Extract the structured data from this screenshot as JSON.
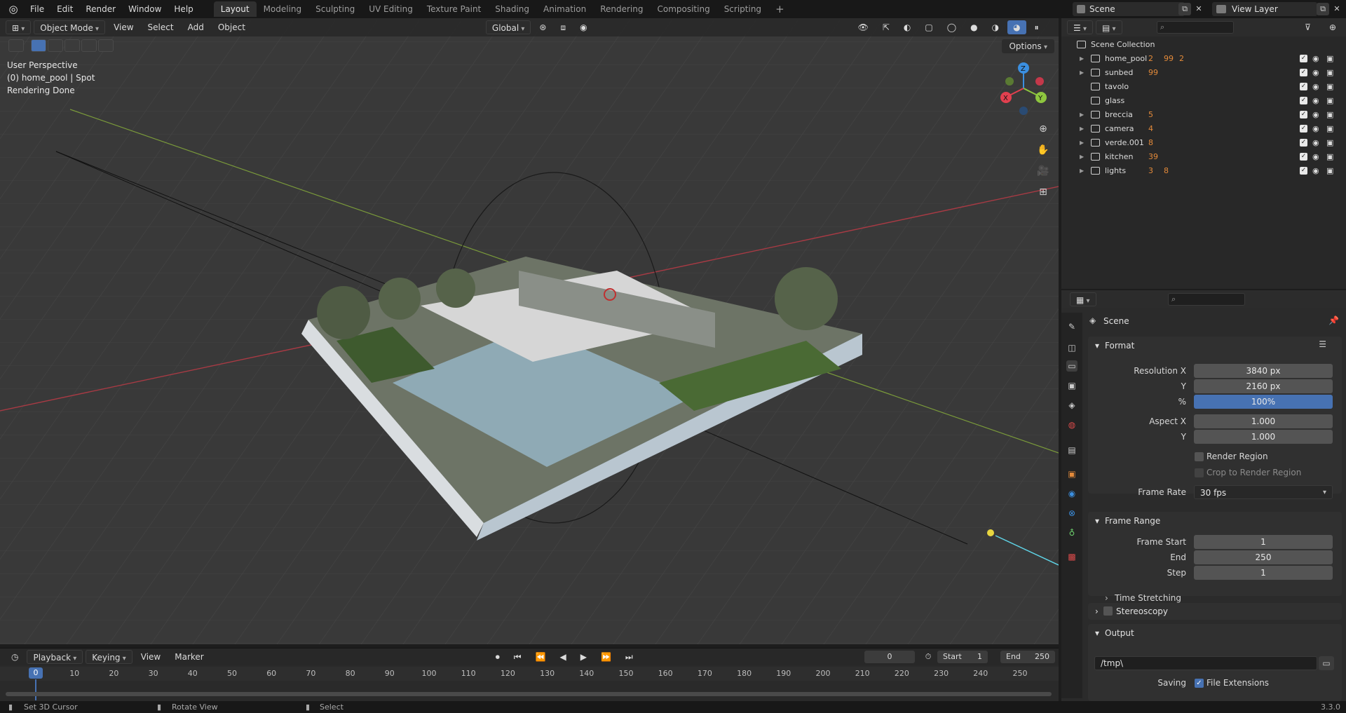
{
  "topbar": {
    "menu": [
      "File",
      "Edit",
      "Render",
      "Window",
      "Help"
    ],
    "workspaces": [
      "Layout",
      "Modeling",
      "Sculpting",
      "UV Editing",
      "Texture Paint",
      "Shading",
      "Animation",
      "Rendering",
      "Compositing",
      "Scripting"
    ],
    "active_workspace": "Layout",
    "add_workspace": "+",
    "scene_name": "Scene",
    "view_layer": "View Layer"
  },
  "viewport": {
    "mode": "Object Mode",
    "menus": [
      "View",
      "Select",
      "Add",
      "Object"
    ],
    "orientation": "Global",
    "options_label": "Options",
    "overlay_lines": [
      "User Perspective",
      "(0) home_pool | Spot",
      "Rendering Done"
    ],
    "gizmo_axes": {
      "x": "X",
      "y": "Y",
      "z": "Z"
    },
    "colors": {
      "x": "#e2404f",
      "y": "#8ec63f",
      "z": "#3b8fe0",
      "grid": "#454545",
      "bg": "#393939"
    }
  },
  "outliner": {
    "root": "Scene Collection",
    "collections": [
      {
        "name": "home_pool",
        "expandable": true,
        "badges": [
          "2",
          "99",
          "2"
        ]
      },
      {
        "name": "sunbed",
        "expandable": true,
        "badges": [
          "99"
        ]
      },
      {
        "name": "tavolo",
        "expandable": false,
        "badges": []
      },
      {
        "name": "glass",
        "expandable": false,
        "badges": []
      },
      {
        "name": "breccia",
        "expandable": true,
        "badges": [
          "5"
        ]
      },
      {
        "name": "camera",
        "expandable": true,
        "badges": [
          "4"
        ]
      },
      {
        "name": "verde.001",
        "expandable": true,
        "badges": [
          "8"
        ]
      },
      {
        "name": "kitchen",
        "expandable": true,
        "badges": [
          "39"
        ]
      },
      {
        "name": "lights",
        "expandable": true,
        "badges": [
          "3",
          "8"
        ]
      }
    ]
  },
  "properties": {
    "context": "Scene",
    "format": {
      "title": "Format",
      "resolution_x_label": "Resolution X",
      "resolution_x": "3840 px",
      "y_label": "Y",
      "resolution_y": "2160 px",
      "percent_label": "%",
      "percent": "100%",
      "aspect_x_label": "Aspect X",
      "aspect_x": "1.000",
      "aspect_y_label": "Y",
      "aspect_y": "1.000",
      "render_region": "Render Region",
      "crop_region": "Crop to Render Region",
      "frame_rate_label": "Frame Rate",
      "frame_rate": "30 fps"
    },
    "frame_range": {
      "title": "Frame Range",
      "start_label": "Frame Start",
      "start": "1",
      "end_label": "End",
      "end": "250",
      "step_label": "Step",
      "step": "1",
      "time_stretching": "Time Stretching"
    },
    "stereoscopy": "Stereoscopy",
    "output": {
      "title": "Output",
      "path": "/tmp\\",
      "saving_label": "Saving",
      "file_extensions": "File Extensions"
    }
  },
  "timeline": {
    "menus": [
      "Playback",
      "Keying",
      "View",
      "Marker"
    ],
    "current_frame": "0",
    "start_label": "Start",
    "start": "1",
    "end_label": "End",
    "end": "250",
    "ticks": [
      "0",
      "10",
      "20",
      "30",
      "40",
      "50",
      "60",
      "70",
      "80",
      "90",
      "100",
      "110",
      "120",
      "130",
      "140",
      "150",
      "160",
      "170",
      "180",
      "190",
      "200",
      "210",
      "220",
      "230",
      "240",
      "250"
    ]
  },
  "statusbar": {
    "hint1": "Set 3D Cursor",
    "hint2": "Rotate View",
    "hint3": "Select",
    "version": "3.3.0"
  }
}
